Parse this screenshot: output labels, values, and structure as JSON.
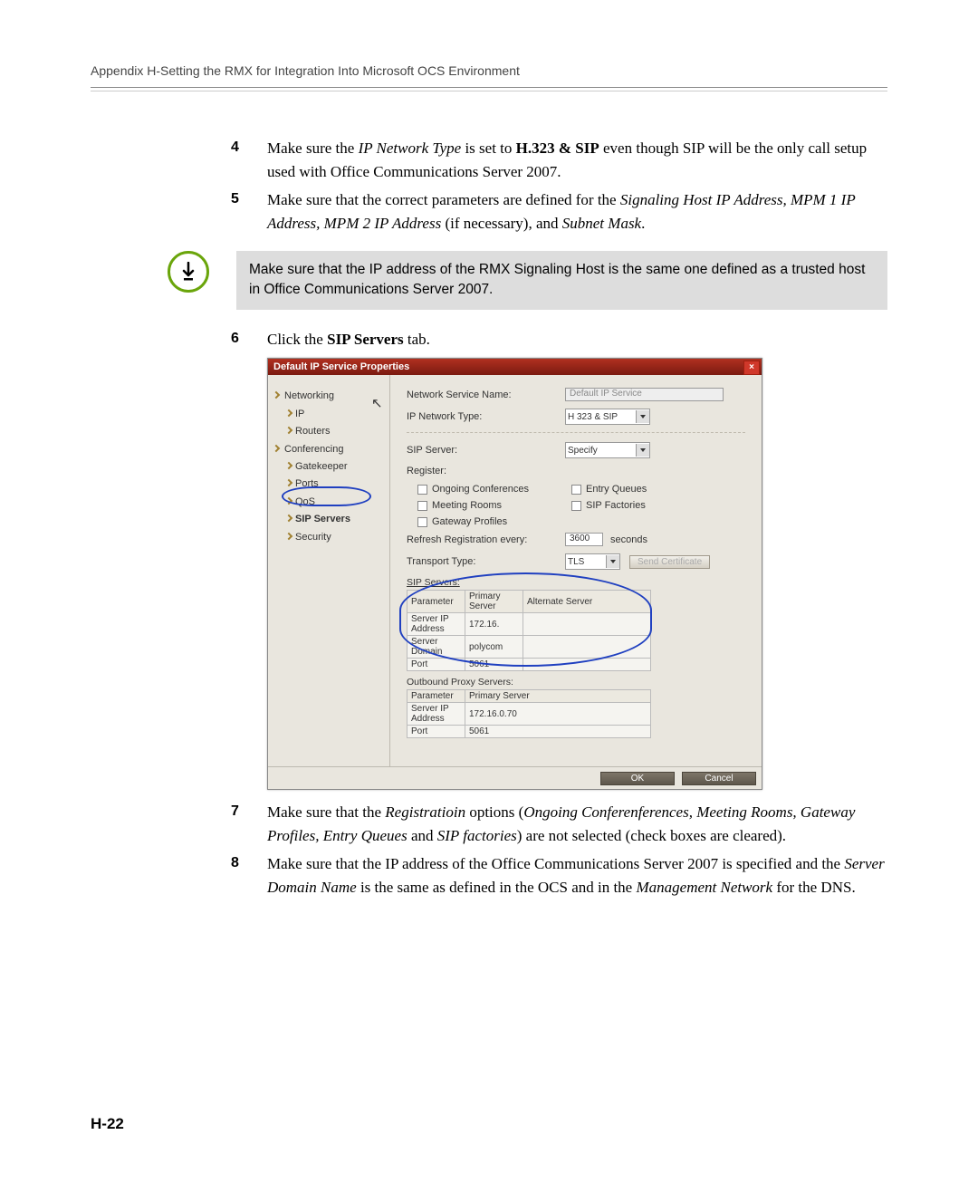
{
  "header": "Appendix H-Setting the RMX for Integration Into Microsoft OCS Environment",
  "steps": {
    "s4": {
      "num": "4",
      "pre": "Make sure the ",
      "it1": "IP Network Type",
      "mid1": " is set to ",
      "b1": "H.323 & SIP",
      "post": " even though SIP will be the only call setup used with Office Communications Server 2007."
    },
    "s5": {
      "num": "5",
      "pre": "Make sure that the correct parameters are defined for the ",
      "it1": "Signaling Host IP Address, MPM 1 IP Address, MPM 2 IP Address",
      "mid": " (if necessary), and ",
      "it2": "Subnet Mask",
      "post": "."
    },
    "s6": {
      "num": "6",
      "pre": "Click the ",
      "b1": "SIP Servers",
      "post": " tab."
    },
    "s7": {
      "num": "7",
      "pre": "Make sure that the ",
      "it1": "Registratioin",
      "mid1": " options (",
      "it2": "Ongoing Conferenferences, Meeting Rooms, Gateway Profiles, Entry Queues",
      "mid2": " and ",
      "it3": "SIP factories",
      "post": ") are not selected (check boxes are cleared)."
    },
    "s8": {
      "num": "8",
      "pre": "Make sure that the IP address of the Office Communications Server 2007 is specified and the ",
      "it1": "Server Domain Name",
      "mid": " is the same as defined in the OCS and in the ",
      "it2": "Management Network",
      "post": " for the DNS."
    }
  },
  "note": "Make sure that the IP address of the RMX Signaling Host is the same one defined as a trusted host in Office Communications Server 2007.",
  "dialog": {
    "title": "Default IP Service Properties",
    "nav": [
      "Networking",
      "IP",
      "Routers",
      "Conferencing",
      "Gatekeeper",
      "Ports",
      "QoS",
      "SIP Servers",
      "Security"
    ],
    "form": {
      "serviceNameLabel": "Network Service Name:",
      "serviceName": "Default IP Service",
      "ipTypeLabel": "IP Network Type:",
      "ipType": "H 323 & SIP",
      "sipServerLabel": "SIP Server:",
      "sipServer": "Specify",
      "registerLabel": "Register:",
      "cb1": "Ongoing Conferences",
      "cb2": "Entry Queues",
      "cb3": "Meeting Rooms",
      "cb4": "SIP Factories",
      "cb5": "Gateway Profiles",
      "refreshLabel": "Refresh Registration every:",
      "refreshVal": "3600",
      "refreshUnit": "seconds",
      "transportLabel": "Transport Type:",
      "transport": "TLS",
      "sendCert": "Send Certificate",
      "sipServersHeading": "SIP Servers:",
      "sipHeaders": [
        "Parameter",
        "Primary Server",
        "Alternate Server"
      ],
      "sipRows": [
        [
          "Server IP Address",
          "172.16.",
          ""
        ],
        [
          "Server Domain",
          "polycom",
          ""
        ],
        [
          "Port",
          "5061",
          ""
        ]
      ],
      "outboundHeading": "Outbound Proxy Servers:",
      "outHeaders": [
        "Parameter",
        "Primary Server"
      ],
      "outRows": [
        [
          "Server IP Address",
          "172.16.0.70"
        ],
        [
          "Port",
          "5061"
        ]
      ],
      "ok": "OK",
      "cancel": "Cancel"
    }
  },
  "footer": "H-22"
}
